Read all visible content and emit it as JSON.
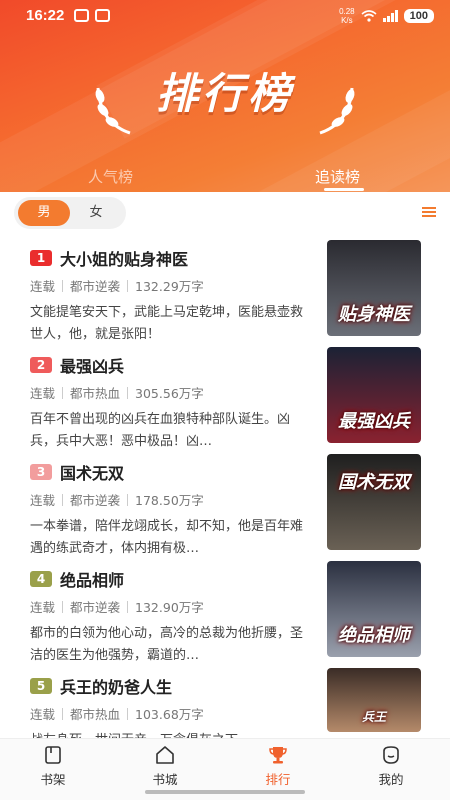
{
  "status_bar": {
    "time": "16:22",
    "net_speed_top": "0.28",
    "net_speed_bottom": "K/s",
    "battery": "100"
  },
  "header": {
    "title": "排行榜"
  },
  "tabs": [
    {
      "label": "人气榜",
      "active": false
    },
    {
      "label": "追读榜",
      "active": true
    }
  ],
  "gender_filter": {
    "male": "男",
    "female": "女",
    "selected": "男"
  },
  "books": [
    {
      "rank": "1",
      "badge_color": "#ea2d2d",
      "title": "大小姐的贴身神医",
      "status": "连载",
      "category": "都市逆袭",
      "words": "132.29万字",
      "desc": "文能提笔安天下，武能上马定乾坤，医能悬壶救世人，他，就是张阳！",
      "cover_text": "贴身神医",
      "cover_colors": [
        "#2a2a30",
        "#6b6f78"
      ]
    },
    {
      "rank": "2",
      "badge_color": "#ef5b5b",
      "title": "最强凶兵",
      "status": "连载",
      "category": "都市热血",
      "words": "305.56万字",
      "desc": "百年不曾出现的凶兵在血狼特种部队诞生。凶兵，兵中大恶！恶中极品！凶…",
      "cover_text": "最强凶兵",
      "cover_colors": [
        "#1b2235",
        "#8a2230"
      ]
    },
    {
      "rank": "3",
      "badge_color": "#f29d9d",
      "title": "国术无双",
      "status": "连载",
      "category": "都市逆袭",
      "words": "178.50万字",
      "desc": "一本拳谱，陪伴龙翊成长，却不知，他是百年难遇的练武奇才，体内拥有极…",
      "cover_text": "国术无双",
      "cover_colors": [
        "#1f1f1f",
        "#6a6155"
      ]
    },
    {
      "rank": "4",
      "badge_color": "#9aa04a",
      "title": "绝品相师",
      "status": "连载",
      "category": "都市逆袭",
      "words": "132.90万字",
      "desc": "都市的白领为他心动，高冷的总裁为他折腰，圣洁的医生为他强势，霸道的…",
      "cover_text": "绝品相师",
      "cover_colors": [
        "#2b3040",
        "#9aa0ad"
      ]
    },
    {
      "rank": "5",
      "badge_color": "#9aa04a",
      "title": "兵王的奶爸人生",
      "status": "连载",
      "category": "都市热血",
      "words": "103.68万字",
      "desc": "战友身死，世间无亲，万念俱灰之下，",
      "cover_text": "兵王",
      "cover_colors": [
        "#3a2c26",
        "#b58a6a"
      ]
    }
  ],
  "bottom_nav": [
    {
      "label": "书架",
      "icon": "bookshelf-icon",
      "active": false
    },
    {
      "label": "书城",
      "icon": "bookstore-icon",
      "active": false
    },
    {
      "label": "排行",
      "icon": "trophy-icon",
      "active": true
    },
    {
      "label": "我的",
      "icon": "profile-icon",
      "active": false
    }
  ],
  "colors": {
    "accent": "#f0612d",
    "header_start": "#f14a2a",
    "header_end": "#f5965a"
  }
}
